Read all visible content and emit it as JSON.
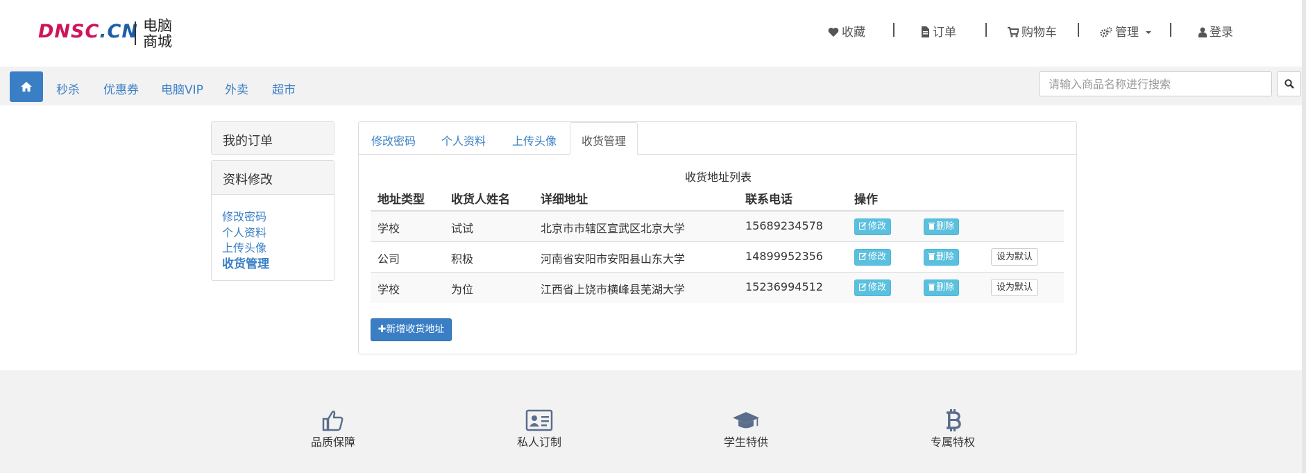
{
  "logo": {
    "text_part1": "DNSC",
    "text_dot": ".",
    "text_part2": "CN",
    "cn_line1": "电脑",
    "cn_line2": "商城"
  },
  "topnav": {
    "favorites": "收藏",
    "orders": "订单",
    "cart": "购物车",
    "manage": "管理",
    "login": "登录"
  },
  "mainnav": {
    "items": [
      "秒杀",
      "优惠券",
      "电脑VIP",
      "外卖",
      "超市"
    ]
  },
  "search": {
    "placeholder": "请输入商品名称进行搜索"
  },
  "sidebar": {
    "my_orders": "我的订单",
    "profile_edit": "资料修改",
    "links": [
      "修改密码",
      "个人资料",
      "上传头像",
      "收货管理"
    ]
  },
  "tabs": [
    "修改密码",
    "个人资料",
    "上传头像",
    "收货管理"
  ],
  "address_table": {
    "caption": "收货地址列表",
    "headers": [
      "地址类型",
      "收货人姓名",
      "详细地址",
      "联系电话",
      "操作"
    ],
    "rows": [
      {
        "type": "学校",
        "name": "试试",
        "address": "北京市市辖区宣武区北京大学",
        "phone": "15689234578"
      },
      {
        "type": "公司",
        "name": "积极",
        "address": "河南省安阳市安阳县山东大学",
        "phone": "14899952356"
      },
      {
        "type": "学校",
        "name": "为位",
        "address": "江西省上饶市横峰县芜湖大学",
        "phone": "15236994512"
      }
    ],
    "edit_label": "修改",
    "delete_label": "删除",
    "set_default_label": "设为默认"
  },
  "add_address_label": "✚新增收货地址",
  "footer": {
    "features": [
      "品质保障",
      "私人订制",
      "学生特供",
      "专属特权"
    ]
  },
  "colors": {
    "primary": "#3a7fc5",
    "info": "#5bc0de",
    "footer_icon": "#5b6d8c"
  }
}
